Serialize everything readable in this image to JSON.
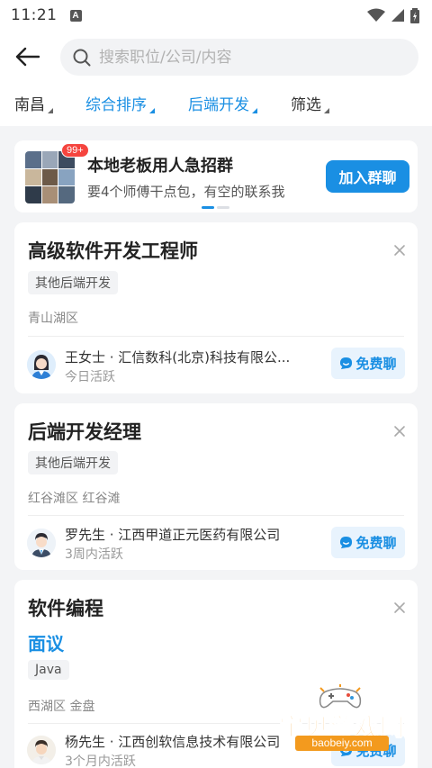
{
  "status_bar": {
    "time": "11:21",
    "notification_letter": "A"
  },
  "search": {
    "placeholder": "搜索职位/公司/内容",
    "value": ""
  },
  "filters": [
    {
      "label": "南昌",
      "active": false
    },
    {
      "label": "综合排序",
      "active": true
    },
    {
      "label": "后端开发",
      "active": true
    },
    {
      "label": "筛选",
      "active": false
    }
  ],
  "banner": {
    "badge": "99+",
    "title": "本地老板用人急招群",
    "subtitle": "要4个师傅干点包，有空的联系我",
    "button_label": "加入群聊"
  },
  "jobs": [
    {
      "title": "高级软件开发工程师",
      "salary": "",
      "tag": "其他后端开发",
      "location": "青山湖区",
      "recruiter": "王女士 · 汇信数科(北京)科技有限公...",
      "active": "今日活跃",
      "chat_label": "免费聊"
    },
    {
      "title": "后端开发经理",
      "salary": "",
      "tag": "其他后端开发",
      "location": "红谷滩区 红谷滩",
      "recruiter": "罗先生 · 江西甲道正元医药有限公司",
      "active": "3周内活跃",
      "chat_label": "免费聊"
    },
    {
      "title": "软件编程",
      "salary": "面议",
      "tag": "Java",
      "location": "西湖区 金盘",
      "recruiter": "杨先生 · 江西创软信息技术有限公司",
      "active": "3个月内活跃",
      "chat_label": "免费聊"
    }
  ],
  "watermark": {
    "name": "宝贝游戏网",
    "url": "baobeiy.com"
  },
  "colors": {
    "accent": "#1a8fe3",
    "badge": "#f5443e",
    "watermark": "#f39a1e"
  }
}
